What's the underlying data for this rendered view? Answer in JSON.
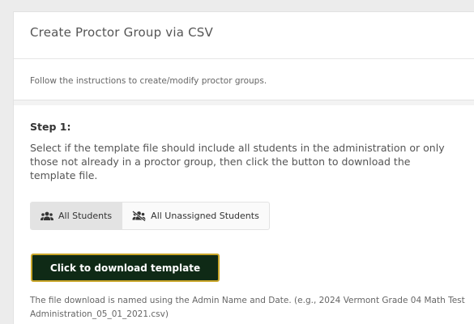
{
  "panel": {
    "title": "Create Proctor Group via CSV",
    "instructions": "Follow the instructions to create/modify proctor groups."
  },
  "step1": {
    "title": "Step 1:",
    "description": "Select if the template file should include all students in the administration or only those not already in a proctor group, then click the button to download the template file.",
    "options": [
      {
        "label": "All Students",
        "icon": "users-icon",
        "selected": true
      },
      {
        "label": "All Unassigned Students",
        "icon": "users-slash-icon",
        "selected": false
      }
    ],
    "download_label": "Click to download template",
    "file_note": "The file download is named using the Admin Name and Date. (e.g., 2024 Vermont Grade 04 Math Test Administration_05_01_2021.csv)"
  },
  "colors": {
    "button_bg": "#0f2a16",
    "button_border": "#c9a62a",
    "selected_toggle": "#e3e3e3"
  }
}
